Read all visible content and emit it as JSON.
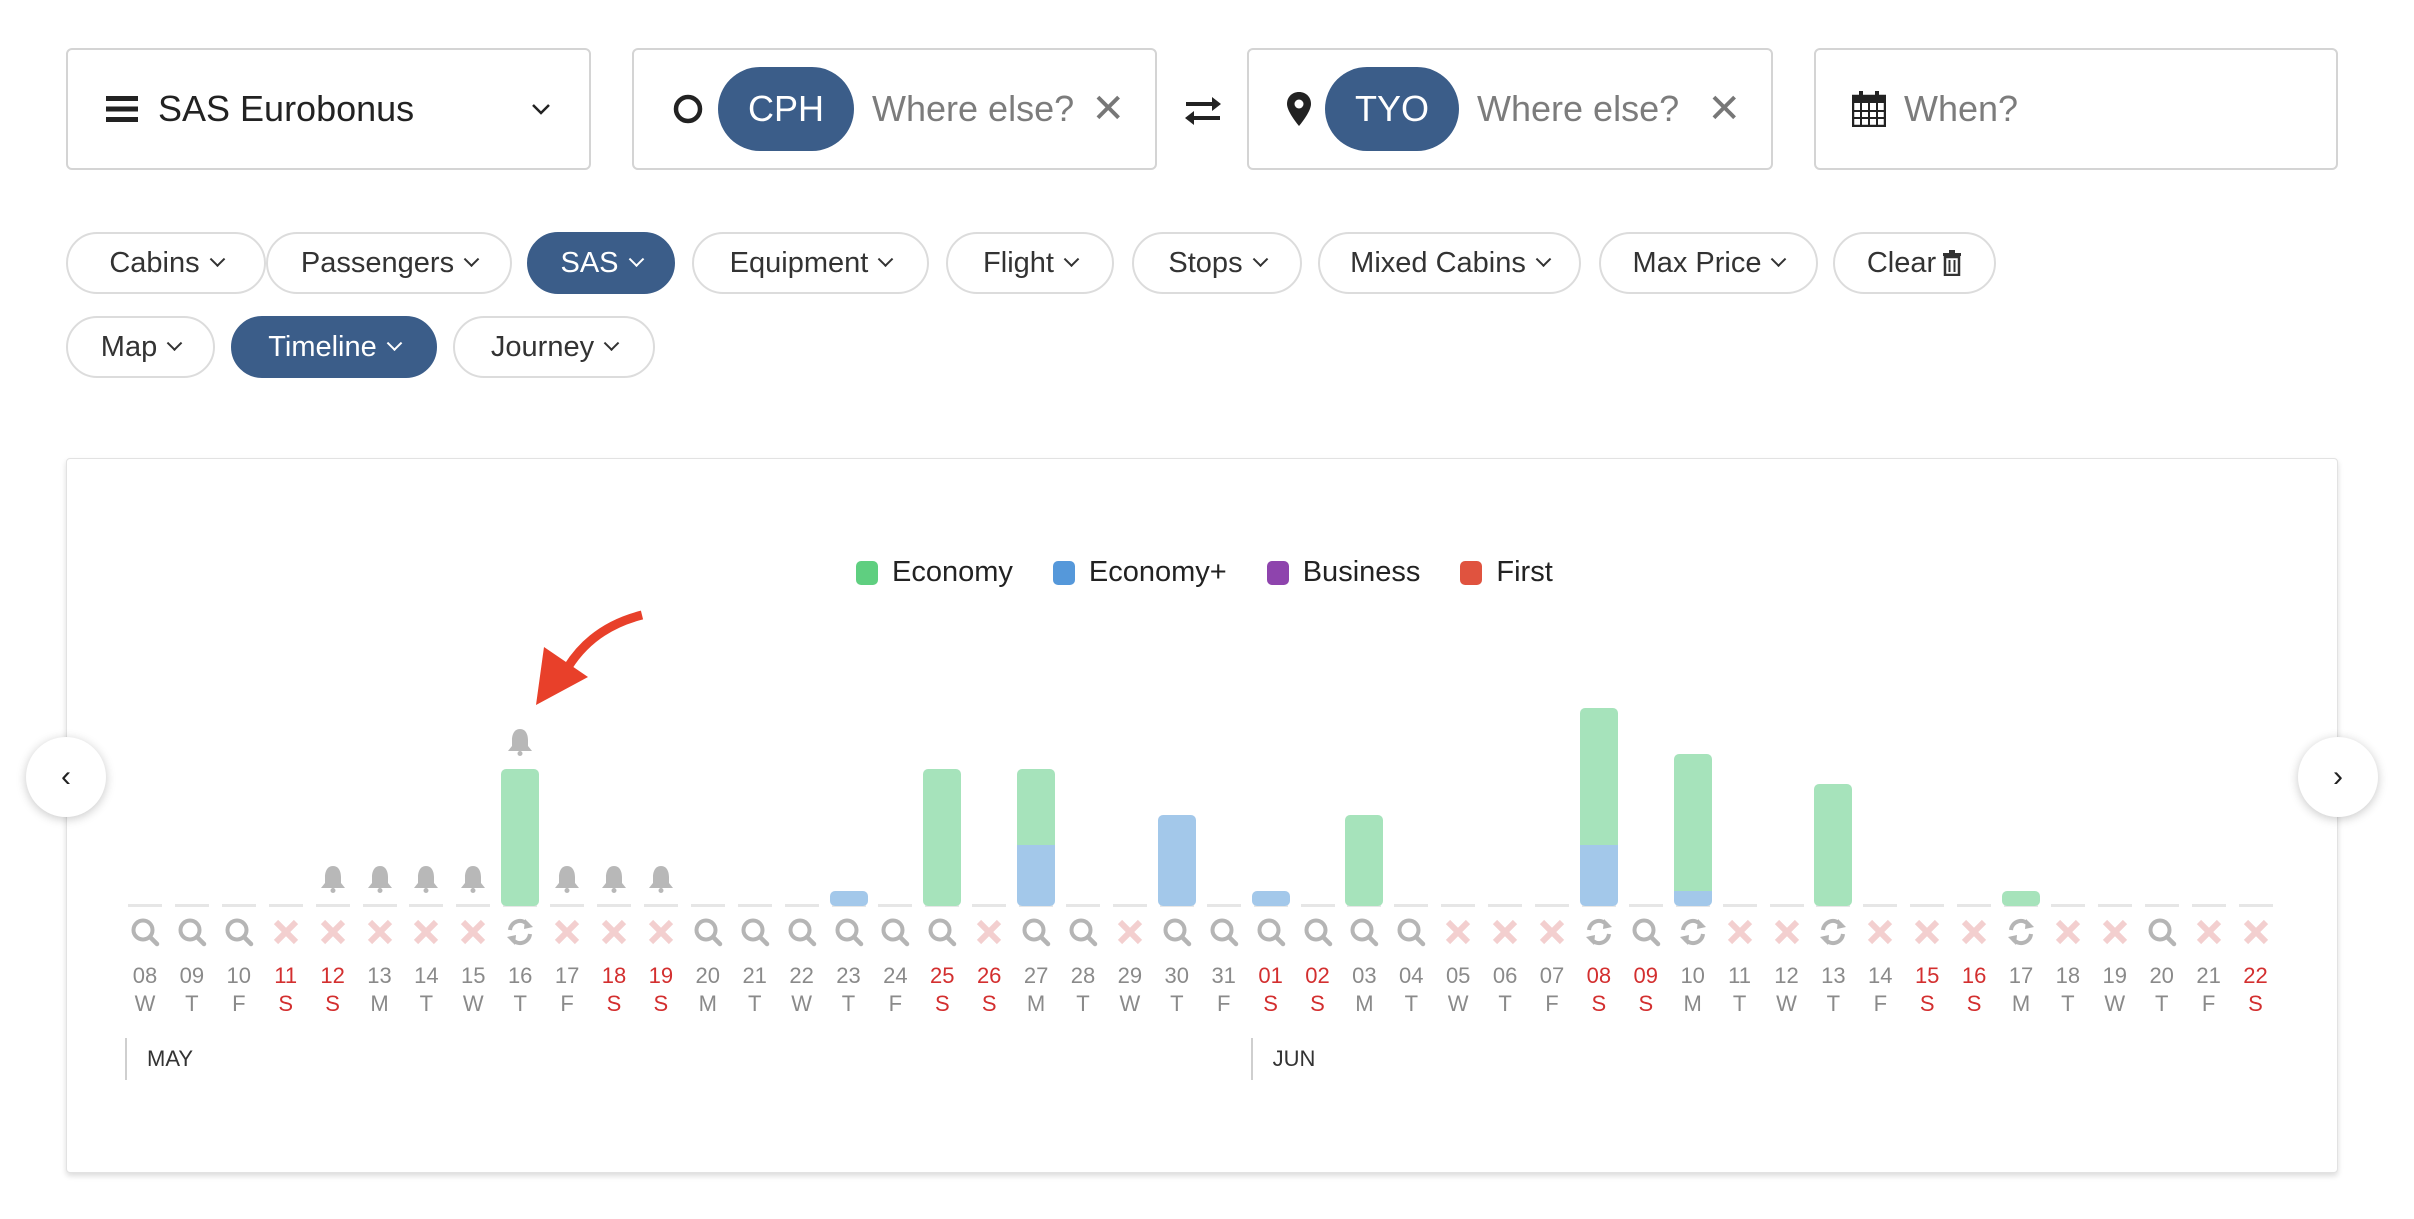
{
  "search": {
    "program": "SAS Eurobonus",
    "origin": {
      "code": "CPH",
      "placeholder": "Where else?"
    },
    "destination": {
      "code": "TYO",
      "placeholder": "Where else?"
    },
    "when_placeholder": "When?"
  },
  "filters": {
    "row1": [
      {
        "label": "Cabins",
        "active": false
      },
      {
        "label": "Passengers",
        "active": false
      },
      {
        "label": "SAS",
        "active": true
      },
      {
        "label": "Equipment",
        "active": false
      },
      {
        "label": "Flight",
        "active": false
      },
      {
        "label": "Stops",
        "active": false
      },
      {
        "label": "Mixed Cabins",
        "active": false
      },
      {
        "label": "Max Price",
        "active": false
      }
    ],
    "clear_label": "Clear",
    "row2": [
      {
        "label": "Map",
        "active": false
      },
      {
        "label": "Timeline",
        "active": true
      },
      {
        "label": "Journey",
        "active": false
      }
    ]
  },
  "nav": {
    "prev": "‹",
    "next": "›"
  },
  "colors": {
    "economy": "#5fcf80",
    "economy_plus": "#5598da",
    "business": "#8e44ad",
    "first": "#e0533f",
    "economy_bar": "#a6e3bb",
    "economy_plus_bar": "#a3c8ea",
    "accent": "#3b5d89",
    "weekend": "#d32f2f"
  },
  "chart_data": {
    "type": "bar",
    "stacked": true,
    "legend": [
      "Economy",
      "Economy+",
      "Business",
      "First"
    ],
    "legend_position": "top-center",
    "months": [
      {
        "label": "MAY",
        "start_index": 0
      },
      {
        "label": "JUN",
        "start_index": 24
      }
    ],
    "days": [
      {
        "d": "08",
        "w": "W",
        "we": false,
        "status": "search",
        "bell": false,
        "eco": 0,
        "ecop": 0
      },
      {
        "d": "09",
        "w": "T",
        "we": false,
        "status": "search",
        "bell": false,
        "eco": 0,
        "ecop": 0
      },
      {
        "d": "10",
        "w": "F",
        "we": false,
        "status": "search",
        "bell": false,
        "eco": 0,
        "ecop": 0
      },
      {
        "d": "11",
        "w": "S",
        "we": true,
        "status": "none",
        "bell": false,
        "eco": 0,
        "ecop": 0
      },
      {
        "d": "12",
        "w": "S",
        "we": true,
        "status": "none",
        "bell": true,
        "eco": 0,
        "ecop": 0
      },
      {
        "d": "13",
        "w": "M",
        "we": false,
        "status": "none",
        "bell": true,
        "eco": 0,
        "ecop": 0
      },
      {
        "d": "14",
        "w": "T",
        "we": false,
        "status": "none",
        "bell": true,
        "eco": 0,
        "ecop": 0
      },
      {
        "d": "15",
        "w": "W",
        "we": false,
        "status": "none",
        "bell": true,
        "eco": 0,
        "ecop": 0
      },
      {
        "d": "16",
        "w": "T",
        "we": false,
        "status": "refresh",
        "bell": true,
        "eco": 9,
        "ecop": 0
      },
      {
        "d": "17",
        "w": "F",
        "we": false,
        "status": "none",
        "bell": true,
        "eco": 0,
        "ecop": 0
      },
      {
        "d": "18",
        "w": "S",
        "we": true,
        "status": "none",
        "bell": true,
        "eco": 0,
        "ecop": 0
      },
      {
        "d": "19",
        "w": "S",
        "we": true,
        "status": "none",
        "bell": true,
        "eco": 0,
        "ecop": 0
      },
      {
        "d": "20",
        "w": "M",
        "we": false,
        "status": "search",
        "bell": false,
        "eco": 0,
        "ecop": 0
      },
      {
        "d": "21",
        "w": "T",
        "we": false,
        "status": "search",
        "bell": false,
        "eco": 0,
        "ecop": 0
      },
      {
        "d": "22",
        "w": "W",
        "we": false,
        "status": "search",
        "bell": false,
        "eco": 0,
        "ecop": 0
      },
      {
        "d": "23",
        "w": "T",
        "we": false,
        "status": "search",
        "bell": false,
        "eco": 0,
        "ecop": 1
      },
      {
        "d": "24",
        "w": "F",
        "we": false,
        "status": "search",
        "bell": false,
        "eco": 0,
        "ecop": 0
      },
      {
        "d": "25",
        "w": "S",
        "we": true,
        "status": "search",
        "bell": false,
        "eco": 9,
        "ecop": 0
      },
      {
        "d": "26",
        "w": "S",
        "we": true,
        "status": "none",
        "bell": false,
        "eco": 0,
        "ecop": 0
      },
      {
        "d": "27",
        "w": "M",
        "we": false,
        "status": "search",
        "bell": false,
        "eco": 5,
        "ecop": 4
      },
      {
        "d": "28",
        "w": "T",
        "we": false,
        "status": "search",
        "bell": false,
        "eco": 0,
        "ecop": 0
      },
      {
        "d": "29",
        "w": "W",
        "we": false,
        "status": "none",
        "bell": false,
        "eco": 0,
        "ecop": 0
      },
      {
        "d": "30",
        "w": "T",
        "we": false,
        "status": "search",
        "bell": false,
        "eco": 0,
        "ecop": 6
      },
      {
        "d": "31",
        "w": "F",
        "we": false,
        "status": "search",
        "bell": false,
        "eco": 0,
        "ecop": 0
      },
      {
        "d": "01",
        "w": "S",
        "we": true,
        "status": "search",
        "bell": false,
        "eco": 0,
        "ecop": 1
      },
      {
        "d": "02",
        "w": "S",
        "we": true,
        "status": "search",
        "bell": false,
        "eco": 0,
        "ecop": 0
      },
      {
        "d": "03",
        "w": "M",
        "we": false,
        "status": "search",
        "bell": false,
        "eco": 6,
        "ecop": 0
      },
      {
        "d": "04",
        "w": "T",
        "we": false,
        "status": "search",
        "bell": false,
        "eco": 0,
        "ecop": 0
      },
      {
        "d": "05",
        "w": "W",
        "we": false,
        "status": "none",
        "bell": false,
        "eco": 0,
        "ecop": 0
      },
      {
        "d": "06",
        "w": "T",
        "we": false,
        "status": "none",
        "bell": false,
        "eco": 0,
        "ecop": 0
      },
      {
        "d": "07",
        "w": "F",
        "we": false,
        "status": "none",
        "bell": false,
        "eco": 0,
        "ecop": 0
      },
      {
        "d": "08",
        "w": "S",
        "we": true,
        "status": "refresh",
        "bell": false,
        "eco": 9,
        "ecop": 4
      },
      {
        "d": "09",
        "w": "S",
        "we": true,
        "status": "search",
        "bell": false,
        "eco": 0,
        "ecop": 0
      },
      {
        "d": "10",
        "w": "M",
        "we": false,
        "status": "refresh",
        "bell": false,
        "eco": 9,
        "ecop": 1
      },
      {
        "d": "11",
        "w": "T",
        "we": false,
        "status": "none",
        "bell": false,
        "eco": 0,
        "ecop": 0
      },
      {
        "d": "12",
        "w": "W",
        "we": false,
        "status": "none",
        "bell": false,
        "eco": 0,
        "ecop": 0
      },
      {
        "d": "13",
        "w": "T",
        "we": false,
        "status": "refresh",
        "bell": false,
        "eco": 8,
        "ecop": 0
      },
      {
        "d": "14",
        "w": "F",
        "we": false,
        "status": "none",
        "bell": false,
        "eco": 0,
        "ecop": 0
      },
      {
        "d": "15",
        "w": "S",
        "we": true,
        "status": "none",
        "bell": false,
        "eco": 0,
        "ecop": 0
      },
      {
        "d": "16",
        "w": "S",
        "we": true,
        "status": "none",
        "bell": false,
        "eco": 0,
        "ecop": 0
      },
      {
        "d": "17",
        "w": "M",
        "we": false,
        "status": "refresh",
        "bell": false,
        "eco": 1,
        "ecop": 0
      },
      {
        "d": "18",
        "w": "T",
        "we": false,
        "status": "none",
        "bell": false,
        "eco": 0,
        "ecop": 0
      },
      {
        "d": "19",
        "w": "W",
        "we": false,
        "status": "none",
        "bell": false,
        "eco": 0,
        "ecop": 0
      },
      {
        "d": "20",
        "w": "T",
        "we": false,
        "status": "search",
        "bell": false,
        "eco": 0,
        "ecop": 0
      },
      {
        "d": "21",
        "w": "F",
        "we": false,
        "status": "none",
        "bell": false,
        "eco": 0,
        "ecop": 0
      },
      {
        "d": "22",
        "w": "S",
        "we": true,
        "status": "none",
        "bell": false,
        "eco": 0,
        "ecop": 0
      }
    ],
    "annotation": "red arrow pointing to alert bell on 16 May"
  }
}
